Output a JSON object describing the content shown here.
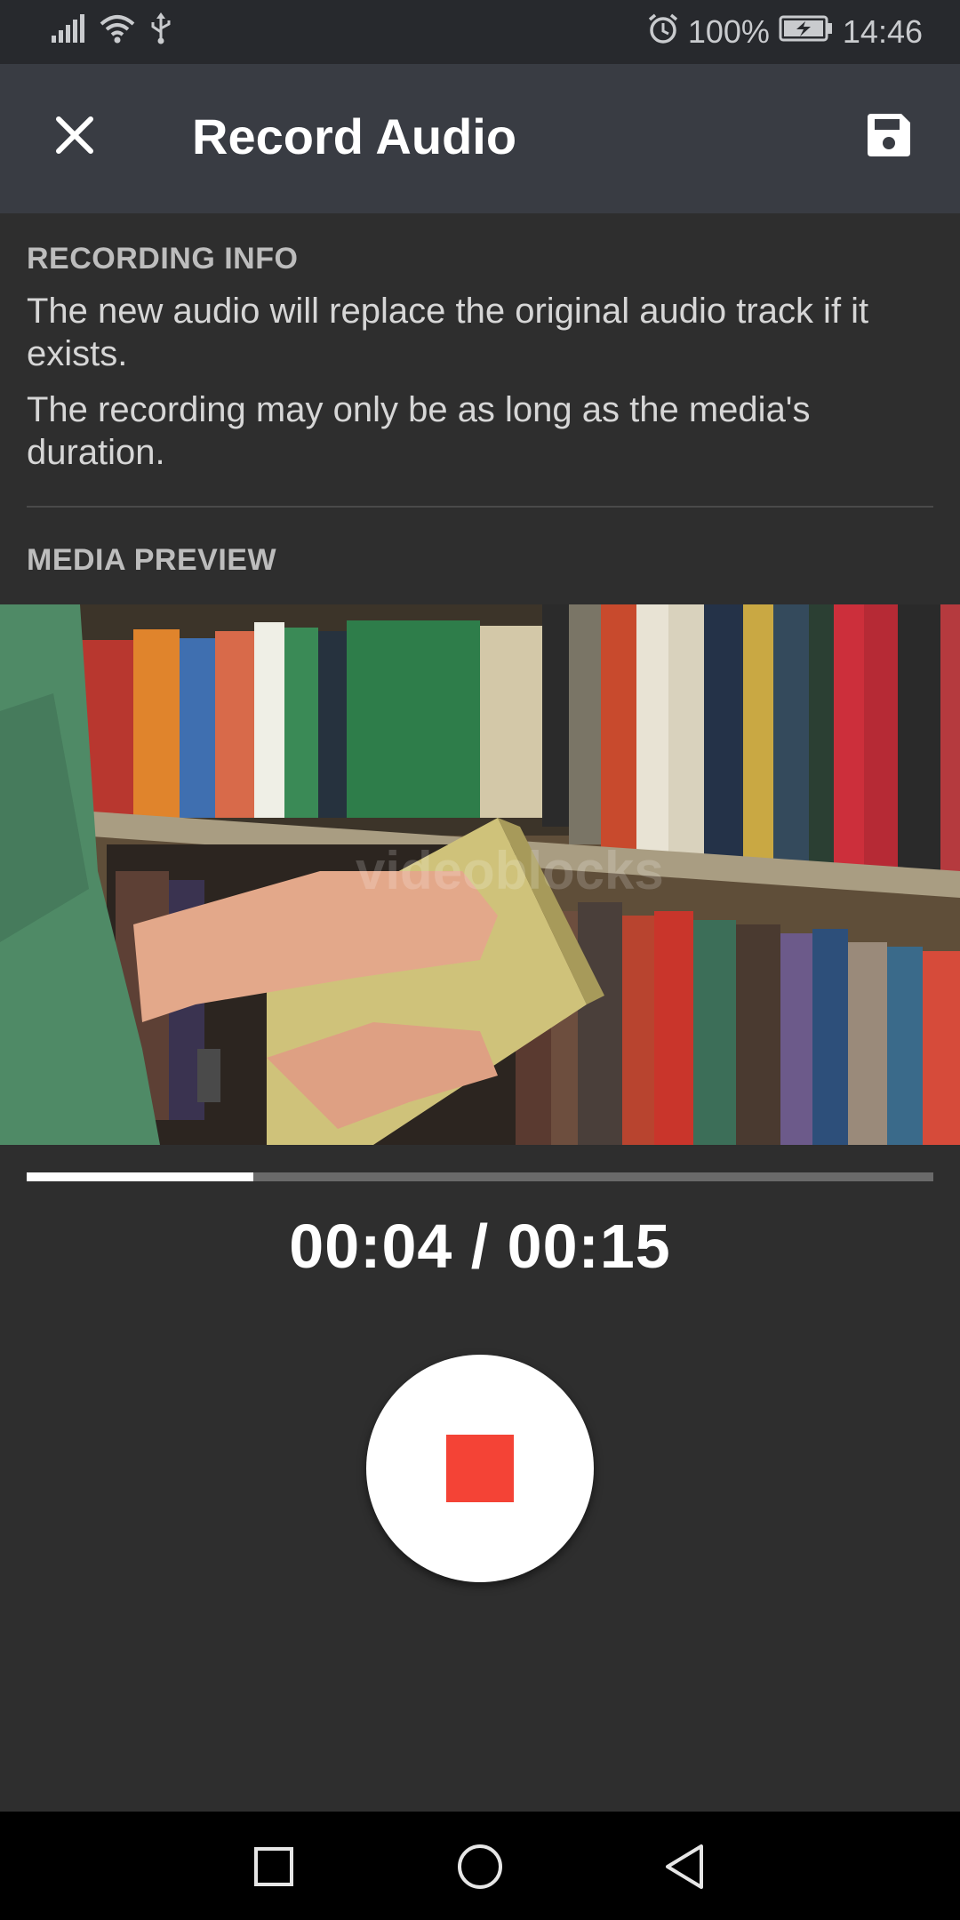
{
  "status_bar": {
    "battery": "100%",
    "time": "14:46",
    "icons": [
      "signal-icon",
      "wifi-icon",
      "usb-icon",
      "alarm-icon",
      "battery-charging-icon"
    ]
  },
  "app_bar": {
    "title": "Record Audio",
    "close_icon": "close-icon",
    "save_icon": "save-icon"
  },
  "recording_info": {
    "heading": "RECORDING INFO",
    "line1": "The new audio will replace the original audio track if it exists.",
    "line2": "The recording may only be as long as the media's duration."
  },
  "media_preview": {
    "heading": "MEDIA PREVIEW",
    "watermark": "videoblocks",
    "progress_fraction": 0.25
  },
  "playback": {
    "time": "00:04 / 00:15"
  },
  "record_button": {
    "icon": "stop-icon",
    "color": "#f44336"
  },
  "nav_bar": {
    "icons": [
      "recents-icon",
      "home-icon",
      "back-icon"
    ]
  }
}
